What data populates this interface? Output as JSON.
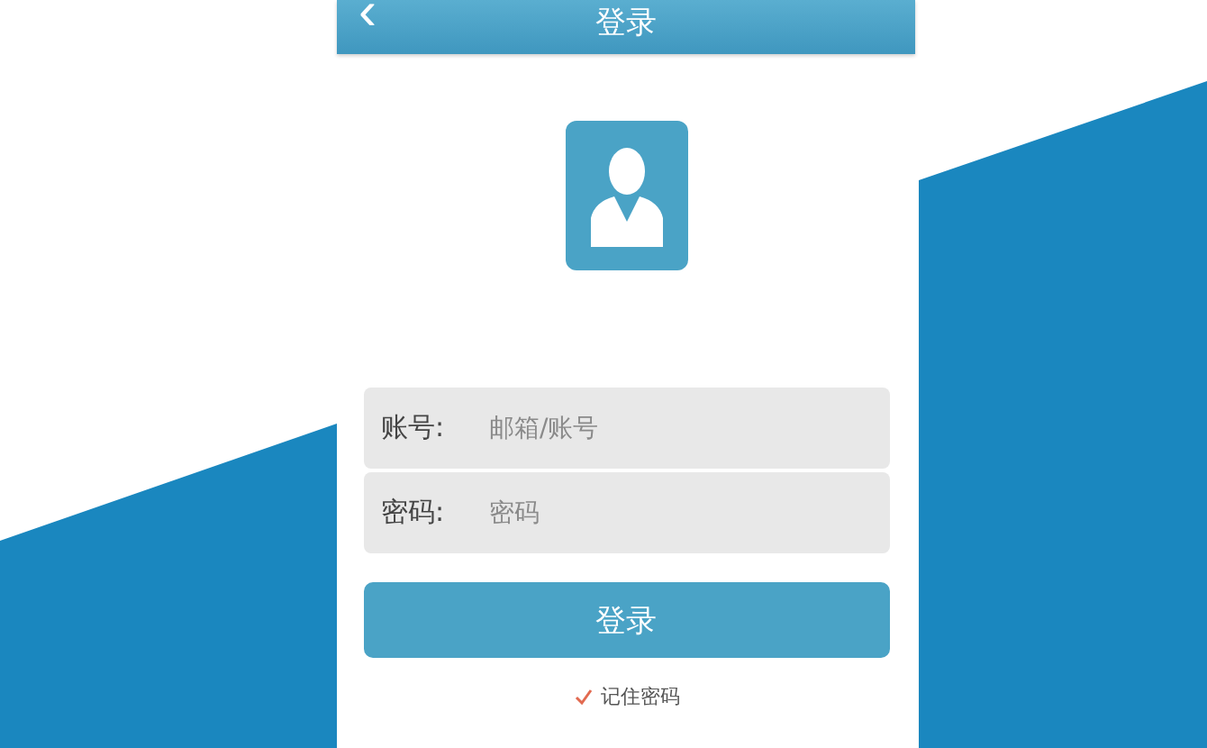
{
  "header": {
    "title": "登录",
    "back": "‹"
  },
  "fields": [
    {
      "label": "账号:",
      "placeholder": "邮箱/账号"
    },
    {
      "label": "密码:",
      "placeholder": "密码"
    }
  ],
  "submit": "登录",
  "remember": {
    "label": "记住密码",
    "checked": true
  }
}
